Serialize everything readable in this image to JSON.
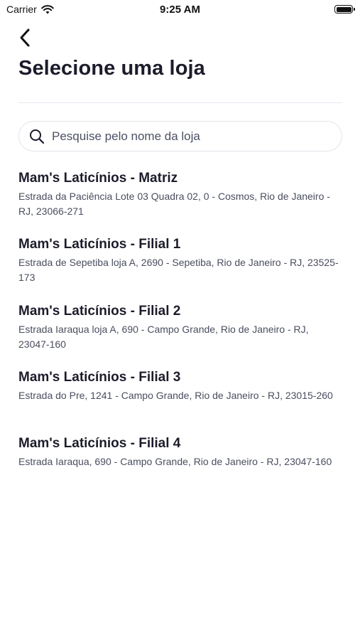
{
  "status_bar": {
    "carrier": "Carrier",
    "time": "9:25 AM",
    "icons": {
      "wifi": "wifi-icon",
      "battery": "battery-icon",
      "battery_level": 1.0
    }
  },
  "header": {
    "back_icon": "chevron-left-icon",
    "title": "Selecione uma loja"
  },
  "search": {
    "icon": "search-icon",
    "placeholder": "Pesquise pelo nome da loja",
    "value": ""
  },
  "stores": [
    {
      "name": "Mam's Laticínios - Matriz",
      "address": "Estrada da Paciência Lote 03  Quadra 02, 0 - Cosmos, Rio de Janeiro - RJ, 23066-271"
    },
    {
      "name": "Mam's Laticínios - Filial 1",
      "address": "Estrada de Sepetiba loja A, 2690 - Sepetiba, Rio de Janeiro - RJ, 23525-173"
    },
    {
      "name": "Mam's Laticínios - Filial 2",
      "address": "Estrada Iaraqua loja A, 690 - Campo Grande, Rio de Janeiro - RJ, 23047-160"
    },
    {
      "name": "Mam's Laticínios - Filial 3",
      "address": "Estrada do Pre, 1241 - Campo Grande, Rio de Janeiro - RJ, 23015-260"
    },
    {
      "name": "Mam's Laticínios - Filial 4",
      "address": "Estrada Iaraqua, 690 - Campo Grande, Rio de Janeiro - RJ, 23047-160"
    }
  ],
  "colors": {
    "text_primary": "#1c1c2b",
    "text_secondary": "#4a4e5f",
    "divider": "#e6e8f0",
    "background": "#ffffff"
  }
}
